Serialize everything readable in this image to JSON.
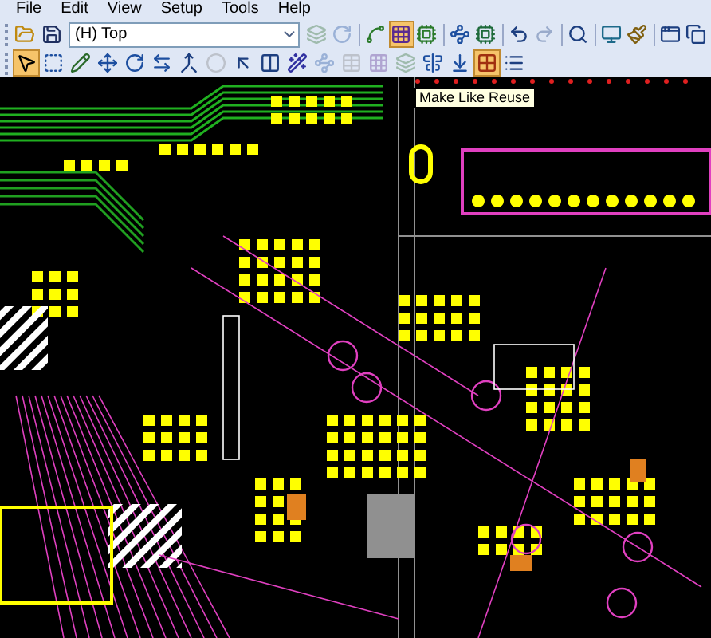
{
  "menu": [
    "File",
    "Edit",
    "View",
    "Setup",
    "Tools",
    "Help"
  ],
  "toolbar_1": {
    "before": [
      {
        "kind": "open",
        "pressed": false,
        "disabled": false
      },
      {
        "kind": "save",
        "pressed": false,
        "disabled": false
      }
    ],
    "layer_select": {
      "value": "(H) Top"
    },
    "after": [
      {
        "kind": "layers",
        "pressed": false,
        "disabled": true
      },
      {
        "kind": "rotate",
        "pressed": false,
        "disabled": true
      },
      {
        "kind": "sep"
      },
      {
        "kind": "route",
        "pressed": false,
        "disabled": false
      },
      {
        "kind": "grid",
        "pressed": true,
        "disabled": false
      },
      {
        "kind": "board",
        "pressed": false,
        "disabled": false
      },
      {
        "kind": "sep"
      },
      {
        "kind": "trace",
        "pressed": false,
        "disabled": false
      },
      {
        "kind": "chip",
        "pressed": false,
        "disabled": false
      },
      {
        "kind": "sep"
      },
      {
        "kind": "undo",
        "pressed": false,
        "disabled": false
      },
      {
        "kind": "redo",
        "pressed": false,
        "disabled": true
      },
      {
        "kind": "sep"
      },
      {
        "kind": "zoom",
        "pressed": false,
        "disabled": false
      },
      {
        "kind": "sep"
      },
      {
        "kind": "monitor",
        "pressed": false,
        "disabled": false
      },
      {
        "kind": "brush",
        "pressed": false,
        "disabled": false
      },
      {
        "kind": "sep"
      },
      {
        "kind": "window",
        "pressed": false,
        "disabled": false
      },
      {
        "kind": "windows",
        "pressed": false,
        "disabled": false
      }
    ]
  },
  "toolbar_2": [
    {
      "kind": "select",
      "pressed": true,
      "disabled": false
    },
    {
      "kind": "box",
      "pressed": false,
      "disabled": false
    },
    {
      "kind": "pencil",
      "pressed": false,
      "disabled": false
    },
    {
      "kind": "move",
      "pressed": false,
      "disabled": false
    },
    {
      "kind": "rotate",
      "pressed": false,
      "disabled": false
    },
    {
      "kind": "swap",
      "pressed": false,
      "disabled": false
    },
    {
      "kind": "merge",
      "pressed": false,
      "disabled": false
    },
    {
      "kind": "circle",
      "pressed": false,
      "disabled": true
    },
    {
      "kind": "arrow",
      "pressed": false,
      "disabled": false
    },
    {
      "kind": "split",
      "pressed": false,
      "disabled": false
    },
    {
      "kind": "wand",
      "pressed": false,
      "disabled": false
    },
    {
      "kind": "trace",
      "pressed": false,
      "disabled": true
    },
    {
      "kind": "table",
      "pressed": false,
      "disabled": true
    },
    {
      "kind": "grid",
      "pressed": false,
      "disabled": true
    },
    {
      "kind": "layers",
      "pressed": false,
      "disabled": true
    },
    {
      "kind": "align",
      "pressed": false,
      "disabled": false
    },
    {
      "kind": "pin",
      "pressed": false,
      "disabled": false
    },
    {
      "kind": "reuse",
      "pressed": true,
      "disabled": false
    },
    {
      "kind": "list",
      "pressed": false,
      "disabled": false
    }
  ],
  "tooltip": "Make Like Reuse"
}
